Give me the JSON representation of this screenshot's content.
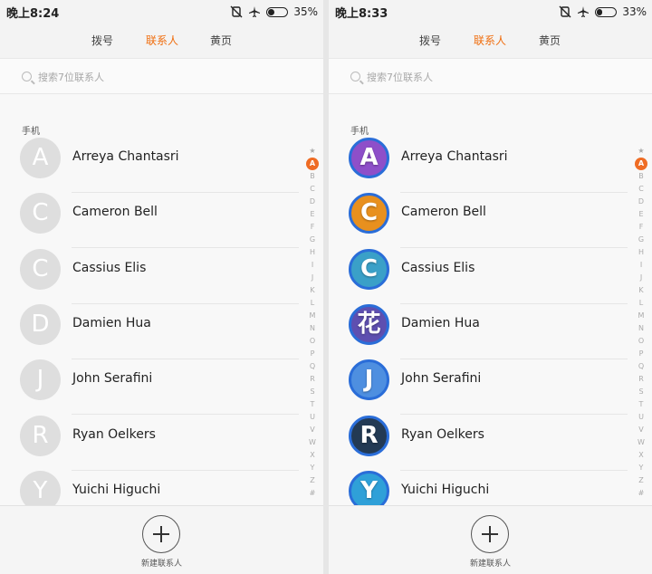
{
  "screens": [
    {
      "status": {
        "time": "晚上8:24",
        "battery_text": "35%",
        "battery_level": 0.35
      },
      "tabs": [
        "拨号",
        "联系人",
        "黄页"
      ],
      "active_tab": "联系人",
      "search": {
        "placeholder": "搜索7位联系人"
      },
      "section_label": "手机",
      "contacts": [
        {
          "name": "Arreya Chantasri",
          "initial": "A"
        },
        {
          "name": "Cameron Bell",
          "initial": "C"
        },
        {
          "name": "Cassius Elis",
          "initial": "C"
        },
        {
          "name": "Damien Hua",
          "initial": "D"
        },
        {
          "name": "John Serafini",
          "initial": "J"
        },
        {
          "name": "Ryan Oelkers",
          "initial": "R"
        },
        {
          "name": "Yuichi Higuchi",
          "initial": "Y"
        }
      ],
      "alphabet": [
        "★",
        "A",
        "B",
        "C",
        "D",
        "E",
        "F",
        "G",
        "H",
        "I",
        "J",
        "K",
        "L",
        "M",
        "N",
        "O",
        "P",
        "Q",
        "R",
        "S",
        "T",
        "U",
        "V",
        "W",
        "X",
        "Y",
        "Z",
        "#"
      ],
      "active_letter": "A",
      "add_label": "新建联系人"
    },
    {
      "status": {
        "time": "晚上8:33",
        "battery_text": "33%",
        "battery_level": 0.33
      },
      "tabs": [
        "拨号",
        "联系人",
        "黄页"
      ],
      "active_tab": "联系人",
      "search": {
        "placeholder": "搜索7位联系人"
      },
      "section_label": "手机",
      "contacts": [
        {
          "name": "Arreya Chantasri",
          "initial": "A",
          "color": "#8e4fc9"
        },
        {
          "name": "Cameron Bell",
          "initial": "C",
          "color": "#e8901e"
        },
        {
          "name": "Cassius Elis",
          "initial": "C",
          "color": "#3aa0c8"
        },
        {
          "name": "Damien Hua",
          "initial": "花",
          "color": "#5e4fb0"
        },
        {
          "name": "John Serafini",
          "initial": "J",
          "color": "#4e8fe0"
        },
        {
          "name": "Ryan Oelkers",
          "initial": "R",
          "color": "#233a54"
        },
        {
          "name": "Yuichi Higuchi",
          "initial": "Y",
          "color": "#2fa0d8"
        }
      ],
      "alphabet": [
        "★",
        "A",
        "B",
        "C",
        "D",
        "E",
        "F",
        "G",
        "H",
        "I",
        "J",
        "K",
        "L",
        "M",
        "N",
        "O",
        "P",
        "Q",
        "R",
        "S",
        "T",
        "U",
        "V",
        "W",
        "X",
        "Y",
        "Z",
        "#"
      ],
      "active_letter": "A",
      "add_label": "新建联系人"
    }
  ]
}
